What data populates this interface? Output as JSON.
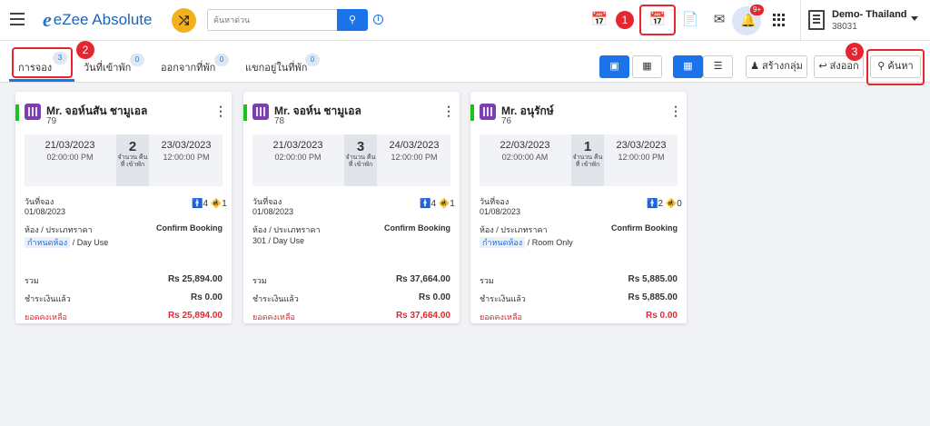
{
  "header": {
    "logo_text": "eZee Absolute",
    "search_placeholder": "ค้นหาด่วน",
    "notification_count": "9+",
    "property_name": "Demo- Thailand",
    "property_code": "38031"
  },
  "markers": [
    "1",
    "2",
    "3"
  ],
  "tabs": [
    {
      "label": "การจอง",
      "count": "3"
    },
    {
      "label": "วันที่เข้าพัก",
      "count": "0"
    },
    {
      "label": "ออกจากที่พัก",
      "count": "0"
    },
    {
      "label": "แขกอยู่ในที่พัก",
      "count": "0"
    }
  ],
  "toolbar": {
    "create_group": "สร้างกลุ่ม",
    "export": "ส่งออก",
    "search": "ค้นหา"
  },
  "labels": {
    "nights": "จำนวน คืนที่ เข้าพัก",
    "booking_date": "วันที่จอง",
    "room_rate": "ห้อง / ประเภทราคา",
    "total": "รวม",
    "paid": "ชำระเงินแล้ว",
    "balance": "ยอดคงเหลือ",
    "assign_room": "กำหนดห้อง"
  },
  "bookings": [
    {
      "guest": "Mr. จอห์นสัน ชามูเอล",
      "res_no": "79",
      "checkin_date": "21/03/2023",
      "checkin_time": "02:00:00 PM",
      "nights": "2",
      "checkout_date": "23/03/2023",
      "checkout_time": "12:00:00 PM",
      "booking_date": "01/08/2023",
      "adults": "4",
      "children": "1",
      "status": "Confirm Booking",
      "room_label": "กำหนดห้อง",
      "rate_type": "/ Day Use",
      "total": "Rs 25,894.00",
      "paid": "Rs 0.00",
      "balance": "Rs 25,894.00"
    },
    {
      "guest": "Mr. จอห์น ชามูเอล",
      "res_no": "78",
      "checkin_date": "21/03/2023",
      "checkin_time": "02:00:00 PM",
      "nights": "3",
      "checkout_date": "24/03/2023",
      "checkout_time": "12:00:00 PM",
      "booking_date": "01/08/2023",
      "adults": "4",
      "children": "1",
      "status": "Confirm Booking",
      "room_label": "301",
      "rate_type": "/ Day Use",
      "total": "Rs 37,664.00",
      "paid": "Rs 0.00",
      "balance": "Rs 37,664.00"
    },
    {
      "guest": "Mr. อนุรักษ์",
      "res_no": "76",
      "checkin_date": "22/03/2023",
      "checkin_time": "02:00:00 AM",
      "nights": "1",
      "checkout_date": "23/03/2023",
      "checkout_time": "12:00:00 PM",
      "booking_date": "01/08/2023",
      "adults": "2",
      "children": "0",
      "status": "Confirm Booking",
      "room_label": "กำหนดห้อง",
      "rate_type": "/ Room Only",
      "total": "Rs 5,885.00",
      "paid": "Rs 5,885.00",
      "balance": "Rs 0.00"
    }
  ]
}
